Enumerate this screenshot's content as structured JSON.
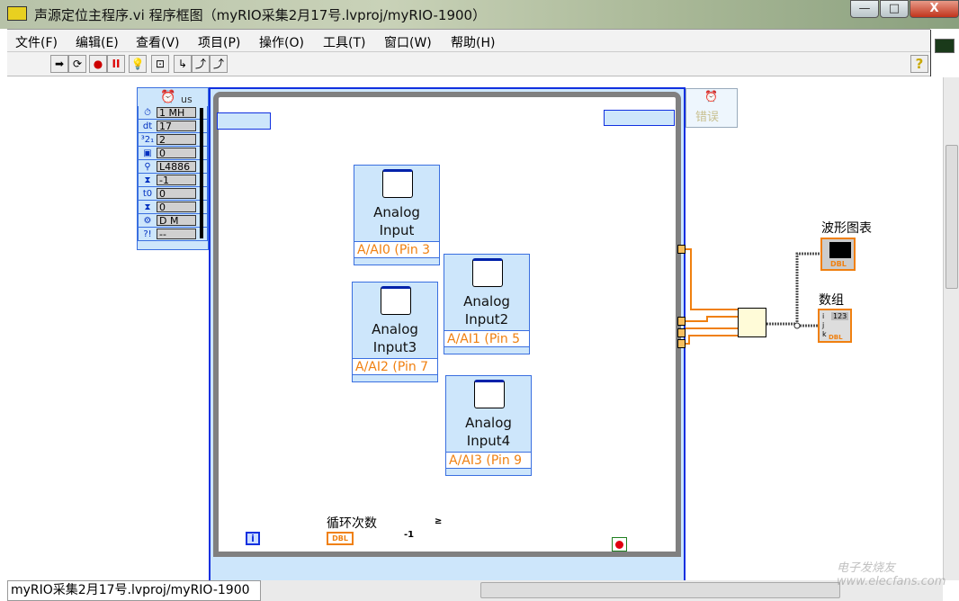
{
  "window": {
    "title": "声源定位主程序.vi 程序框图（myRIO采集2月17号.lvproj/myRIO-1900）",
    "minimize": "—",
    "maximize": "□",
    "close": "X"
  },
  "menu": [
    "文件(F)",
    "编辑(E)",
    "查看(V)",
    "项目(P)",
    "操作(O)",
    "工具(T)",
    "窗口(W)",
    "帮助(H)"
  ],
  "toolbar": {
    "run": "➡",
    "run_continuous": "⟳",
    "abort": "●",
    "pause": "II",
    "highlight": "💡",
    "retain": "⊡",
    "step_into": "↳",
    "step_over": "⤴",
    "step_out": "⤴",
    "help": "?"
  },
  "timed_loop": {
    "unit": "us",
    "inputs": [
      {
        "icon": "clock-icon",
        "value": "1 MH"
      },
      {
        "icon": "dt",
        "value": "17"
      },
      {
        "icon": "priority",
        "value": "2"
      },
      {
        "icon": "processor",
        "value": "0"
      },
      {
        "icon": "name",
        "value": "L4886"
      },
      {
        "icon": "deadline",
        "value": "-1"
      },
      {
        "icon": "t0",
        "value": "0"
      },
      {
        "icon": "timeout",
        "value": "0"
      },
      {
        "icon": "mode",
        "value": "D M"
      },
      {
        "icon": "error",
        "value": "--"
      }
    ],
    "error_out_label": "错误"
  },
  "blocks": [
    {
      "title1": "Analog",
      "title2": "Input",
      "pin": "A/AI0 (Pin 3"
    },
    {
      "title1": "Analog",
      "title2": "Input2",
      "pin": "A/AI1 (Pin 5"
    },
    {
      "title1": "Analog",
      "title2": "Input3",
      "pin": "A/AI2 (Pin 7"
    },
    {
      "title1": "Analog",
      "title2": "Input4",
      "pin": "A/AI3 (Pin 9"
    }
  ],
  "indicators": {
    "chart_label": "波形图表",
    "array_label": "数组",
    "dbl": "DBL",
    "array_num": "123",
    "idx": [
      "i",
      "j",
      "k"
    ]
  },
  "loop_logic": {
    "iteration": "i",
    "count_label": "循环次数",
    "count_type": "DBL",
    "decrement": "-1",
    "compare": "≥"
  },
  "status": {
    "path": "myRIO采集2月17号.lvproj/myRIO-1900"
  },
  "watermark": "电子发烧友 www.elecfans.com"
}
